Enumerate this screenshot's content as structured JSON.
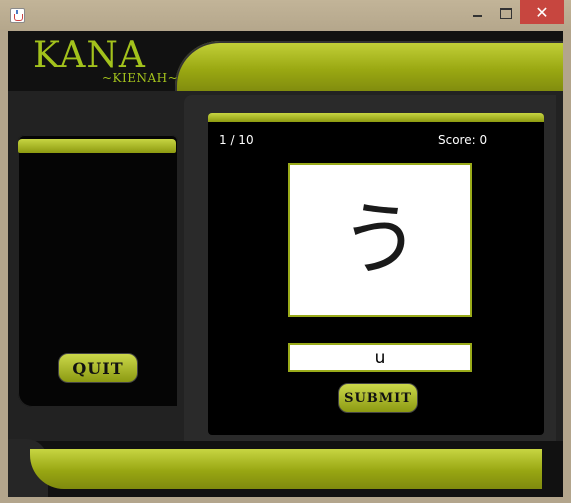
{
  "window": {
    "icon": "java-cup-icon",
    "controls": {
      "minimize": "minimize-icon",
      "maximize": "maximize-icon",
      "close": "✕"
    }
  },
  "logo": {
    "title": "KANA",
    "subtitle": "~KIENAH~"
  },
  "sidebar": {
    "quit_label": "QUIT"
  },
  "quiz": {
    "progress": "1 / 10",
    "score": "Score: 0",
    "kana": "う",
    "answer_value": "u",
    "submit_label": "SUBMIT"
  },
  "colors": {
    "accent": "#a3c21c",
    "panel": "#000000",
    "frame": "#b3a58c",
    "close": "#c7463f"
  }
}
